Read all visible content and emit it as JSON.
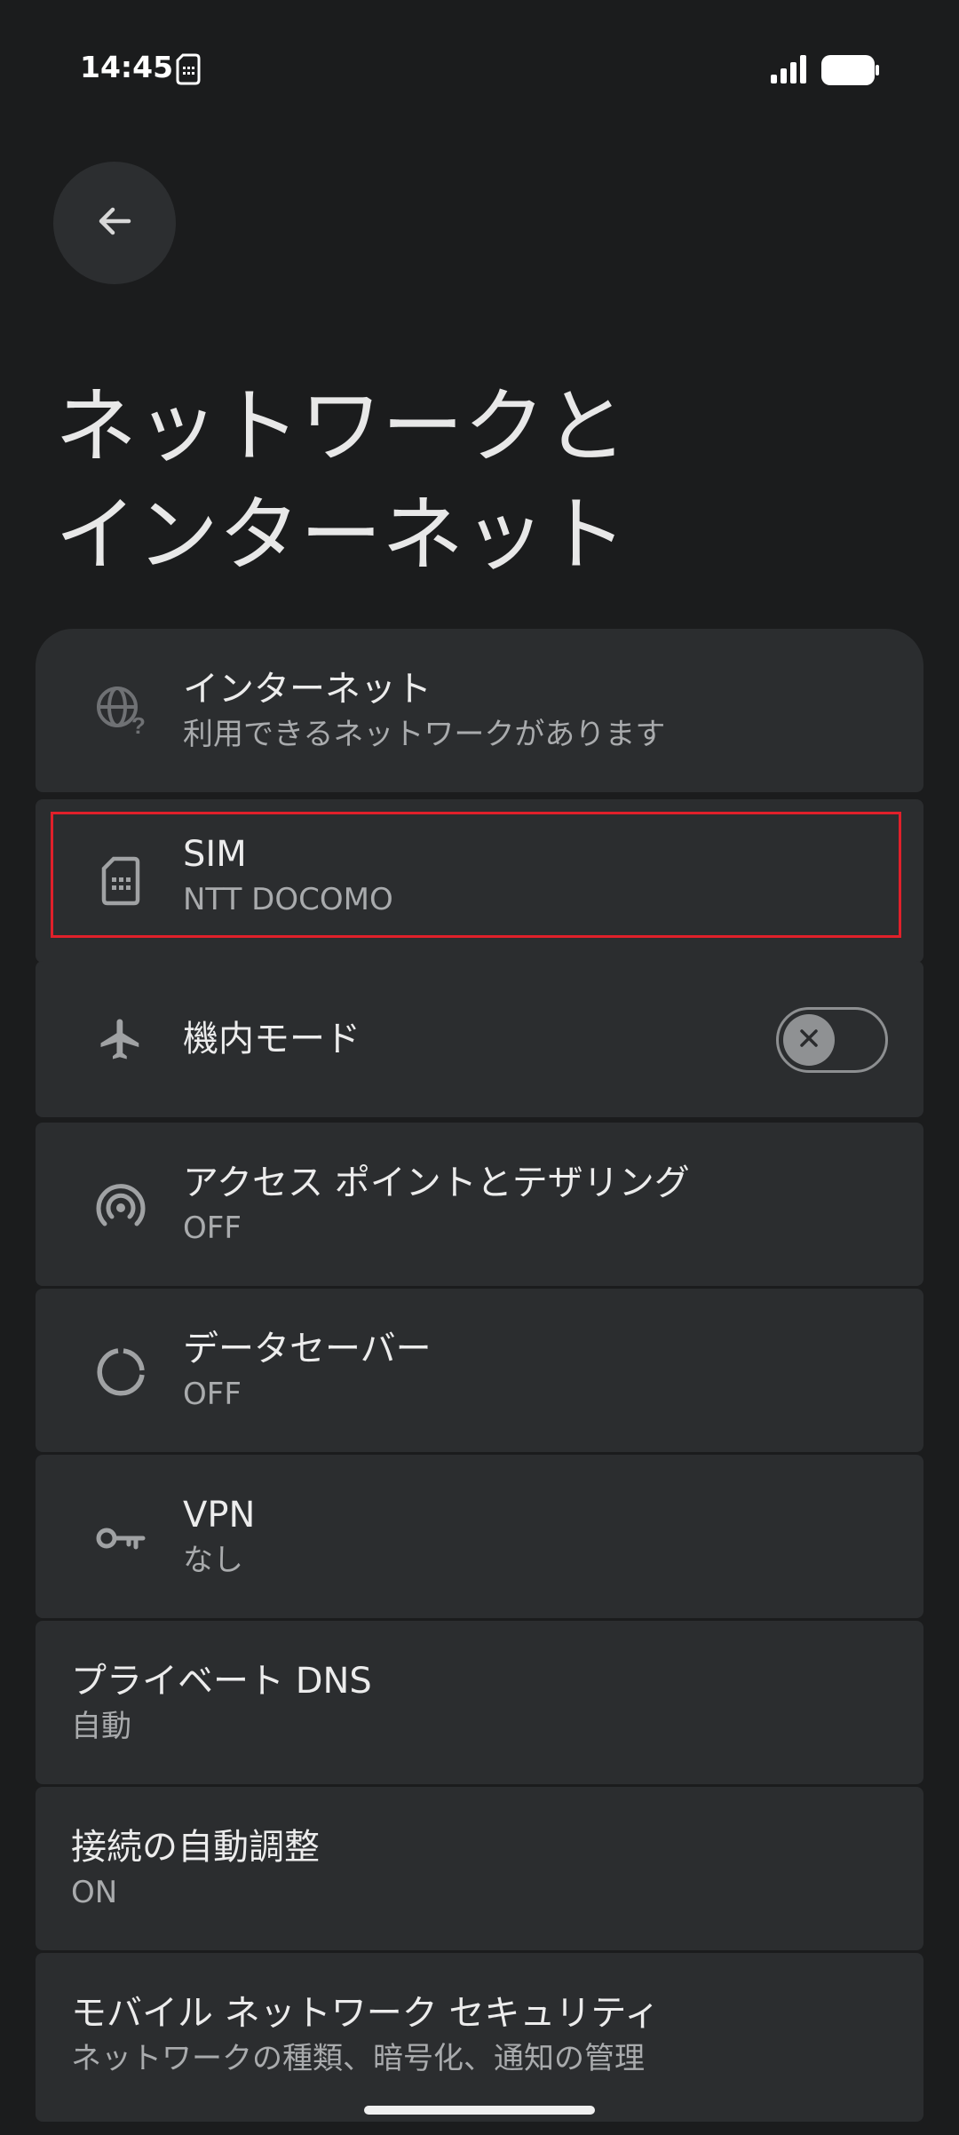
{
  "status_bar": {
    "time": "14:45"
  },
  "header": {
    "title": "ネットワークと\nインターネット"
  },
  "settings": {
    "internet": {
      "label": "インターネット",
      "sub": "利用できるネットワークがあります"
    },
    "sim": {
      "label": "SIM",
      "sub": "NTT DOCOMO"
    },
    "airplane": {
      "label": "機内モード",
      "toggle_on": false
    },
    "hotspot": {
      "label": "アクセス ポイントとテザリング",
      "sub": "OFF"
    },
    "data_saver": {
      "label": "データセーバー",
      "sub": "OFF"
    },
    "vpn": {
      "label": "VPN",
      "sub": "なし"
    },
    "private_dns": {
      "label": "プライベート DNS",
      "sub": "自動"
    },
    "adaptive": {
      "label": "接続の自動調整",
      "sub": "ON"
    },
    "mobile_security": {
      "label": "モバイル ネットワーク セキュリティ",
      "sub": "ネットワークの種類、暗号化、通知の管理"
    }
  },
  "colors": {
    "background": "#1b1c1d",
    "card": "#2b2d2f",
    "highlight": "#e0202a"
  },
  "icons": [
    "sim-icon",
    "signal-icon",
    "battery-icon",
    "back-arrow-icon",
    "globe-question-icon",
    "sim-card-icon",
    "airplane-icon",
    "hotspot-icon",
    "data-saver-icon",
    "vpn-key-icon",
    "close-icon"
  ]
}
